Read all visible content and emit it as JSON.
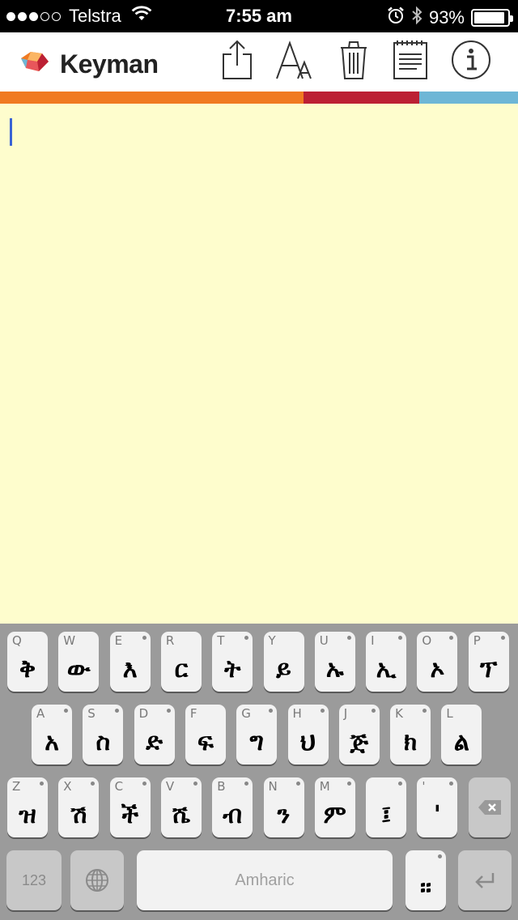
{
  "status_bar": {
    "carrier": "Telstra",
    "time": "7:55 am",
    "battery_percent_text": "93%",
    "battery_level": 0.93
  },
  "app_bar": {
    "app_name": "Keyman",
    "tools": [
      "share-icon",
      "font-size-icon",
      "trash-icon",
      "notepad-icon",
      "info-icon"
    ]
  },
  "brand_colors": {
    "orange": "#f07a22",
    "red": "#bc2034",
    "blue": "#6eb6d6"
  },
  "editor": {
    "text": ""
  },
  "keyboard": {
    "row1": [
      {
        "hint": "Q",
        "glyph": "ቅ",
        "pop": false
      },
      {
        "hint": "W",
        "glyph": "ው",
        "pop": false
      },
      {
        "hint": "E",
        "glyph": "እ",
        "pop": true
      },
      {
        "hint": "R",
        "glyph": "ር",
        "pop": false
      },
      {
        "hint": "T",
        "glyph": "ት",
        "pop": true
      },
      {
        "hint": "Y",
        "glyph": "ይ",
        "pop": false
      },
      {
        "hint": "U",
        "glyph": "ኡ",
        "pop": true
      },
      {
        "hint": "I",
        "glyph": "ኢ",
        "pop": true
      },
      {
        "hint": "O",
        "glyph": "ኦ",
        "pop": true
      },
      {
        "hint": "P",
        "glyph": "ፕ",
        "pop": true
      }
    ],
    "row2": [
      {
        "hint": "A",
        "glyph": "አ",
        "pop": true
      },
      {
        "hint": "S",
        "glyph": "ስ",
        "pop": true
      },
      {
        "hint": "D",
        "glyph": "ድ",
        "pop": true
      },
      {
        "hint": "F",
        "glyph": "ፍ",
        "pop": false
      },
      {
        "hint": "G",
        "glyph": "ግ",
        "pop": true
      },
      {
        "hint": "H",
        "glyph": "ህ",
        "pop": true
      },
      {
        "hint": "J",
        "glyph": "ጅ",
        "pop": true
      },
      {
        "hint": "K",
        "glyph": "ክ",
        "pop": true
      },
      {
        "hint": "L",
        "glyph": "ል",
        "pop": false
      }
    ],
    "row3": [
      {
        "hint": "Z",
        "glyph": "ዝ",
        "pop": true
      },
      {
        "hint": "X",
        "glyph": "ሽ",
        "pop": true
      },
      {
        "hint": "C",
        "glyph": "ች",
        "pop": true
      },
      {
        "hint": "V",
        "glyph": "ሼ",
        "pop": true
      },
      {
        "hint": "B",
        "glyph": "ብ",
        "pop": true
      },
      {
        "hint": "N",
        "glyph": "ን",
        "pop": true
      },
      {
        "hint": "M",
        "glyph": "ም",
        "pop": true
      },
      {
        "hint": "",
        "glyph": "፤",
        "pop": true
      },
      {
        "hint": "'",
        "glyph": "'",
        "pop": true
      }
    ],
    "numbers_label": "123",
    "space_label": "Amharic",
    "punct_glyph": "።"
  }
}
